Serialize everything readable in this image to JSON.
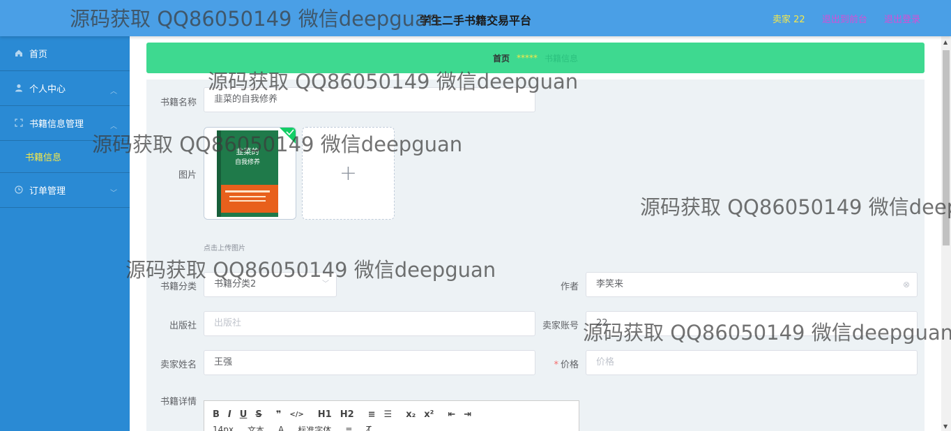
{
  "header": {
    "title": "学生二手书籍交易平台",
    "user_label": "卖家 22",
    "front_link": "退出到前台",
    "logout_link": "退出登录"
  },
  "sidebar": {
    "items": [
      {
        "label": "首页",
        "icon": "home-icon"
      },
      {
        "label": "个人中心",
        "icon": "user-icon"
      },
      {
        "label": "书籍信息管理",
        "icon": "book-manage-icon"
      },
      {
        "label": "书籍信息",
        "icon": ""
      },
      {
        "label": "订单管理",
        "icon": "clock-icon"
      }
    ]
  },
  "breadcrumb": {
    "home": "首页",
    "separator": "*****",
    "current": "书籍信息"
  },
  "form": {
    "book_name_label": "书籍名称",
    "book_name_value": "韭菜的自我修养",
    "image_label": "图片",
    "image_title_line1": "韭菜的",
    "image_title_line2": "自我修养",
    "upload_hint": "点击上传图片",
    "category_label": "书籍分类",
    "category_value": "书籍分类2",
    "author_label": "作者",
    "author_value": "李笑来",
    "publisher_label": "出版社",
    "publisher_placeholder": "出版社",
    "seller_account_label": "卖家账号",
    "seller_account_value": "22",
    "seller_name_label": "卖家姓名",
    "seller_name_value": "王强",
    "price_label": "价格",
    "price_placeholder": "价格",
    "details_label": "书籍详情"
  },
  "editor": {
    "toolbar_row1": [
      "B",
      "I",
      "U",
      "S",
      "❞",
      "</>",
      "H1",
      "H2",
      "≡",
      "☰",
      "x₂",
      "x²",
      "⇤",
      "⇥"
    ],
    "font_size": "14px",
    "text_style": "文本",
    "font_family": "标准字体"
  },
  "watermark": "源码获取 QQ86050149 微信deepguan",
  "colors": {
    "header_bg": "#4a9fe6",
    "sidebar_bg": "#2a8ad4",
    "breadcrumb_bg": "#3ed990",
    "accent_yellow": "#f5e84a",
    "link_pink": "#d44fd6"
  }
}
